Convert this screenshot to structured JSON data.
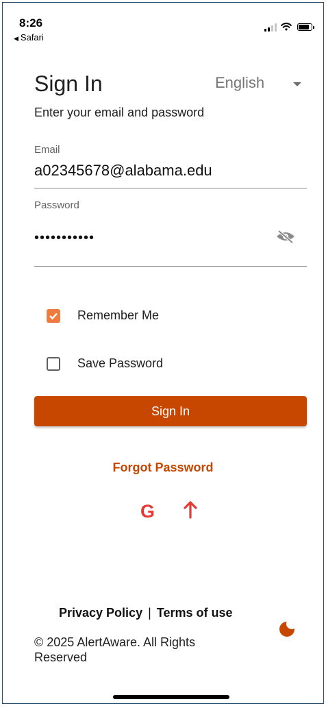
{
  "status_bar": {
    "time": "8:26",
    "back_label": "Safari"
  },
  "header": {
    "title": "Sign In",
    "language": "English",
    "subtitle": "Enter your email and password"
  },
  "form": {
    "email_label": "Email",
    "email_value": "a02345678@alabama.edu",
    "password_label": "Password",
    "password_masked": "•••••••••••",
    "remember_label": "Remember Me",
    "remember_checked": true,
    "save_password_label": "Save Password",
    "save_password_checked": false,
    "submit_label": "Sign In",
    "forgot_label": "Forgot Password"
  },
  "social": {
    "google_glyph": "G",
    "upload_icon": "arrow-up-icon"
  },
  "footer": {
    "privacy_label": "Privacy Policy",
    "separator": "|",
    "terms_label": "Terms of use",
    "copyright": "© 2025 AlertAware. All Rights Reserved"
  },
  "colors": {
    "accent": "#c74600",
    "checkbox": "#f07b3f",
    "social": "#e53935"
  }
}
